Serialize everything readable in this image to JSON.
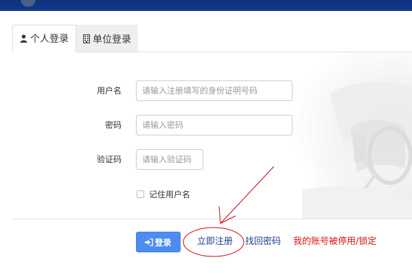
{
  "tabs": [
    {
      "label": "个人登录",
      "icon": "user-icon",
      "active": true
    },
    {
      "label": "单位登录",
      "icon": "building-icon",
      "active": false
    }
  ],
  "form": {
    "username_label": "用户名",
    "username_placeholder": "请输入注册填写的身份证明号码",
    "password_label": "密码",
    "password_placeholder": "请输入密码",
    "captcha_label": "验证码",
    "captcha_placeholder": "请输入验证码",
    "remember_label": "记住用户名"
  },
  "actions": {
    "login_label": "登录",
    "login_icon": "sign-in-icon",
    "register_label": "立即注册",
    "find_password_label": "找回密码",
    "account_locked_label": "我的账号被停用/锁定"
  },
  "colors": {
    "top_bar": "#0c2f7d",
    "login_button": "#4b8df0",
    "link": "#1d3c8f",
    "warning_link": "#dd1111",
    "annotation": "#cc0000"
  }
}
